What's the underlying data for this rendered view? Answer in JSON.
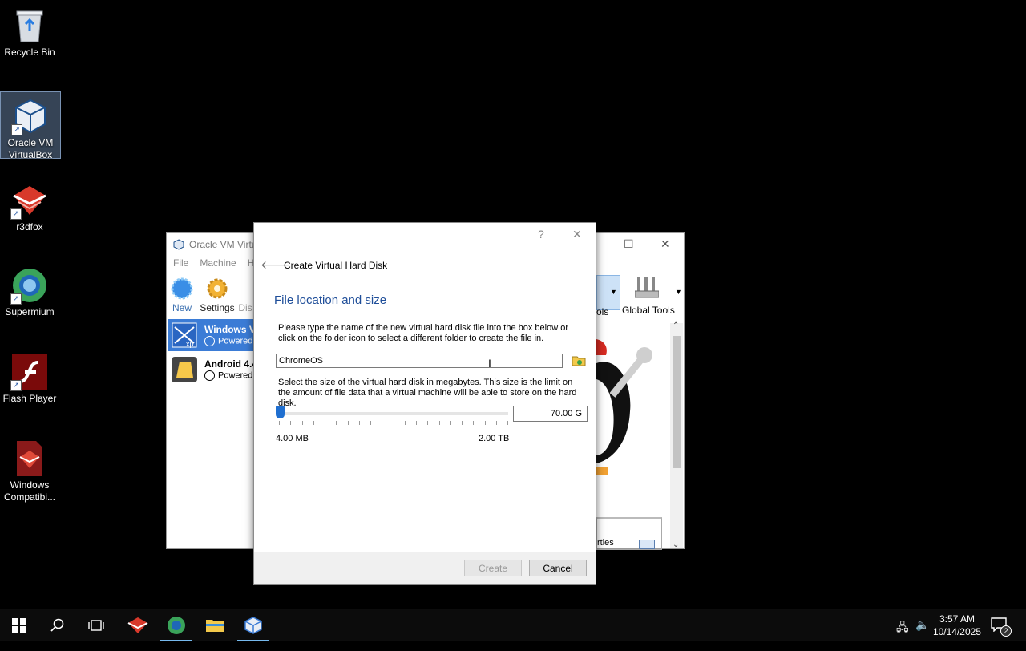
{
  "desktop": {
    "icons": [
      {
        "label": "Recycle Bin"
      },
      {
        "label": "Oracle VM VirtualBox"
      },
      {
        "label": "r3dfox"
      },
      {
        "label": "Supermium"
      },
      {
        "label": "Flash Player"
      },
      {
        "label": "Windows Compatibi..."
      }
    ]
  },
  "vbox_manager": {
    "title": "Oracle VM Virtu",
    "menu": [
      "File",
      "Machine",
      "H"
    ],
    "toolbar": {
      "new": "New",
      "settings": "Settings",
      "discard": "Dis"
    },
    "vms": [
      {
        "name": "Windows Vi",
        "state": "Powered"
      },
      {
        "name": "Android 4.4",
        "state": "Powered"
      }
    ],
    "tools_label": "ols",
    "global_tools_label": "Global Tools",
    "properties_label": "rties"
  },
  "dialog": {
    "help": "?",
    "close": "✕",
    "title": "Create Virtual Hard Disk",
    "heading": "File location and size",
    "location_desc": "Please type the name of the new virtual hard disk file into the box below or click on the folder icon to select a different folder to create the file in.",
    "file_name": "ChromeOS",
    "size_desc": "Select the size of the virtual hard disk in megabytes. This size is the limit on the amount of file data that a virtual machine will be able to store on the hard disk.",
    "size_value": "70.00 G",
    "slider_min": "4.00 MB",
    "slider_max": "2.00 TB",
    "slider_fraction": 0.0,
    "create_label": "Create",
    "cancel_label": "Cancel"
  },
  "taskbar": {
    "time": "3:57 AM",
    "date": "10/14/2025",
    "notification_count": "2"
  }
}
